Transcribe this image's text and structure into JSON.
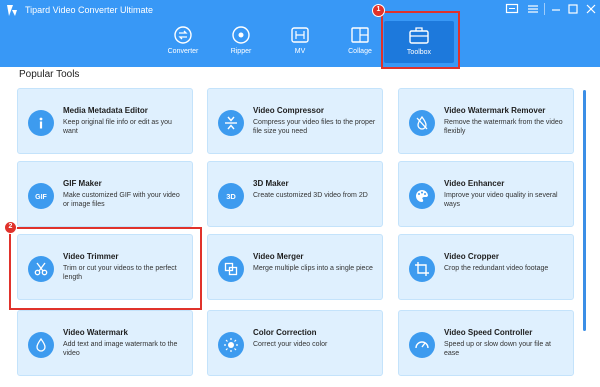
{
  "app": {
    "title": "Tipard Video Converter Ultimate"
  },
  "icons": [
    "logo-icon",
    "chat-icon",
    "menu-icon",
    "minimize-icon",
    "maximize-icon",
    "close-icon",
    "converter-icon",
    "ripper-icon",
    "mv-icon",
    "collage-icon",
    "toolbox-icon"
  ],
  "colors": {
    "header": "#3898f6",
    "active_tab": "#1d79dc",
    "card_bg": "#dff0fe",
    "icon_circle": "#3d9bef",
    "highlight": "#e0322b"
  },
  "nav": {
    "tabs": [
      {
        "label": "Converter"
      },
      {
        "label": "Ripper"
      },
      {
        "label": "MV"
      },
      {
        "label": "Collage"
      },
      {
        "label": "Toolbox"
      }
    ]
  },
  "annotations": {
    "step1": "1",
    "step2": "2"
  },
  "section": {
    "title": "Popular Tools"
  },
  "tools": [
    {
      "title": "Media Metadata Editor",
      "desc": "Keep original file info or edit as you want",
      "icon": "info-icon"
    },
    {
      "title": "Video Compressor",
      "desc": "Compress your video files to the proper file size you need",
      "icon": "compress-icon"
    },
    {
      "title": "Video Watermark Remover",
      "desc": "Remove the watermark from the video flexibly",
      "icon": "water-drop-off-icon"
    },
    {
      "title": "GIF Maker",
      "desc": "Make customized GIF with your video or image files",
      "icon": "gif-icon"
    },
    {
      "title": "3D Maker",
      "desc": "Create customized 3D video from 2D",
      "icon": "3d-icon"
    },
    {
      "title": "Video Enhancer",
      "desc": "Improve your video quality in several ways",
      "icon": "palette-icon"
    },
    {
      "title": "Video Trimmer",
      "desc": "Trim or cut your videos to the perfect length",
      "icon": "scissors-icon"
    },
    {
      "title": "Video Merger",
      "desc": "Merge multiple clips into a single piece",
      "icon": "merge-icon"
    },
    {
      "title": "Video Cropper",
      "desc": "Crop the redundant video footage",
      "icon": "crop-icon"
    },
    {
      "title": "Video Watermark",
      "desc": "Add text and image watermark to the video",
      "icon": "water-drop-icon"
    },
    {
      "title": "Color Correction",
      "desc": "Correct your video color",
      "icon": "sun-icon"
    },
    {
      "title": "Video Speed Controller",
      "desc": "Speed up or slow down your file at ease",
      "icon": "speedometer-icon"
    }
  ]
}
